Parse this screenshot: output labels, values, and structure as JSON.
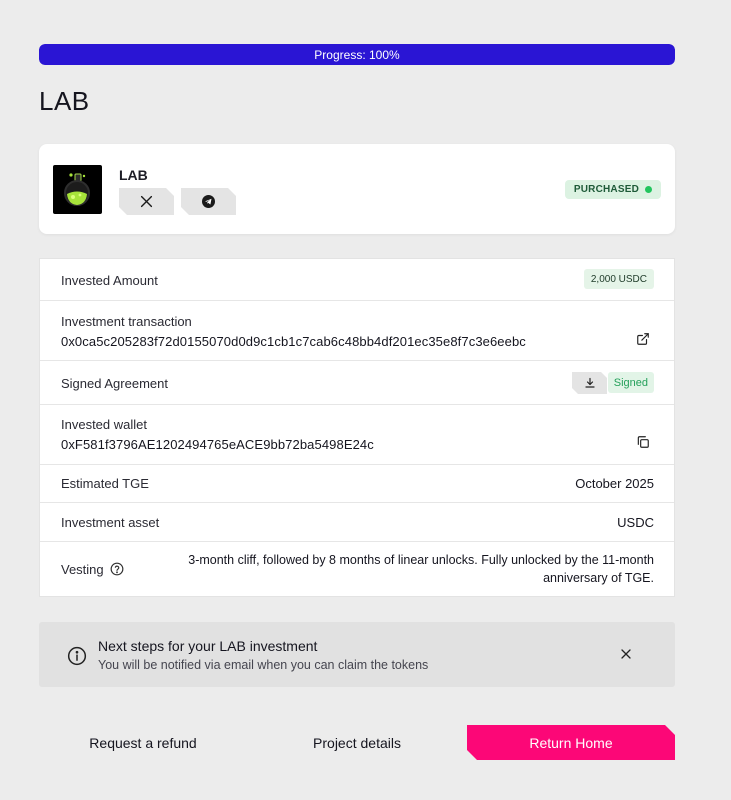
{
  "progress": {
    "label": "Progress: 100%",
    "percent": 100,
    "color": "#2a15d4"
  },
  "page_title": "LAB",
  "project": {
    "name": "LAB",
    "status": "PURCHASED",
    "social": [
      {
        "name": "x-icon",
        "label": "X"
      },
      {
        "name": "telegram-icon",
        "label": "Telegram"
      }
    ]
  },
  "details": {
    "invested_amount": {
      "label": "Invested Amount",
      "value": "2,000 USDC"
    },
    "investment_transaction": {
      "label": "Investment transaction",
      "value": "0x0ca5c205283f72d0155070d0d9c1cb1c7cab6c48bb4df201ec35e8f7c3e6eebc"
    },
    "signed_agreement": {
      "label": "Signed Agreement",
      "status": "Signed"
    },
    "invested_wallet": {
      "label": "Invested wallet",
      "value": "0xF581f3796AE1202494765eACE9bb72ba5498E24c"
    },
    "estimated_tge": {
      "label": "Estimated TGE",
      "value": "October 2025"
    },
    "investment_asset": {
      "label": "Investment asset",
      "value": "USDC"
    },
    "vesting": {
      "label": "Vesting",
      "value": "3-month cliff, followed by 8 months of linear unlocks. Fully unlocked by the 11-month anniversary of TGE."
    }
  },
  "notice": {
    "title": "Next steps for your LAB investment",
    "body": "You will be notified via email when you can claim the tokens"
  },
  "actions": {
    "refund": "Request a refund",
    "project_details": "Project details",
    "return_home": "Return Home"
  },
  "colors": {
    "accent": "#fc0777",
    "progress": "#2a15d4",
    "status_green": "#22c55e"
  }
}
